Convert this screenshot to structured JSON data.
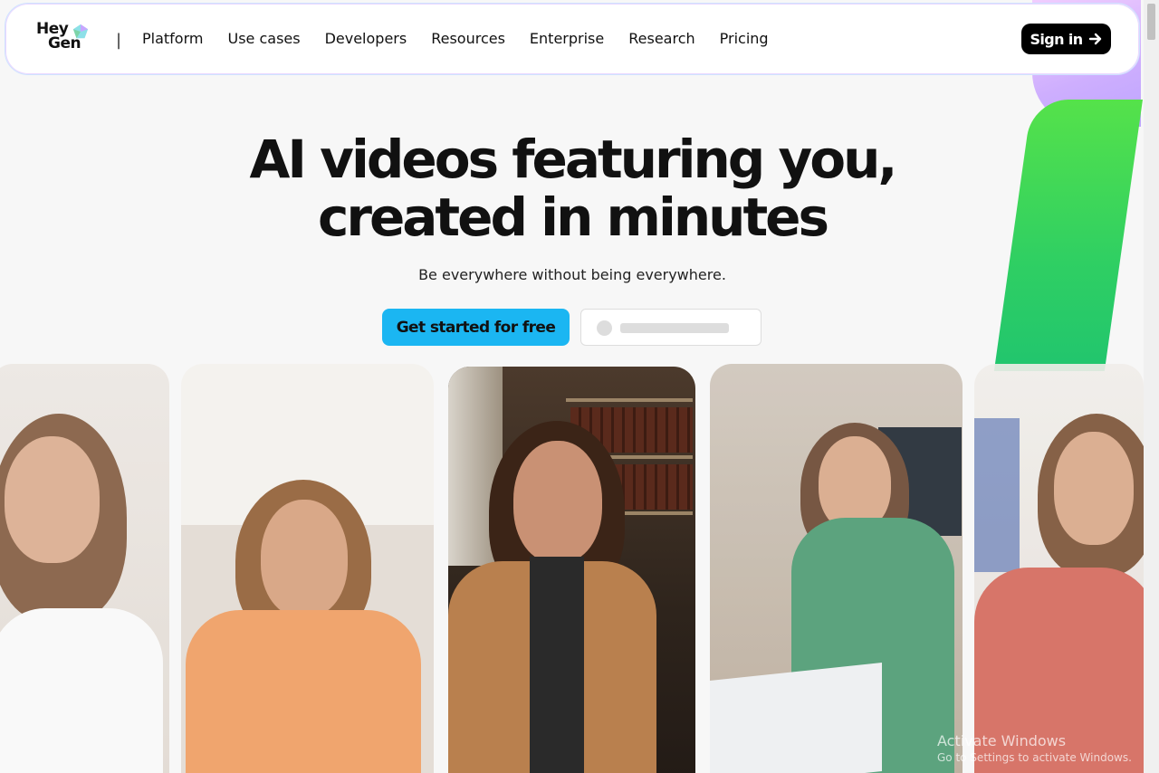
{
  "brand": {
    "line1": "Hey",
    "line2": "Gen"
  },
  "nav": {
    "separator": "|",
    "items": [
      "Platform",
      "Use cases",
      "Developers",
      "Resources",
      "Enterprise",
      "Research",
      "Pricing"
    ],
    "signin_label": "Sign in"
  },
  "hero": {
    "headline_line1": "AI videos featuring you,",
    "headline_line2": "created in minutes",
    "subtitle": "Be everywhere without being everywhere.",
    "cta_label": "Get started for free"
  },
  "watermark": {
    "title": "Activate Windows",
    "subtitle": "Go to Settings to activate Windows."
  },
  "colors": {
    "accent": "#1bb6f2",
    "signin_bg": "#000000",
    "green": "#2fcf63",
    "purple": "#c9a6ff"
  }
}
